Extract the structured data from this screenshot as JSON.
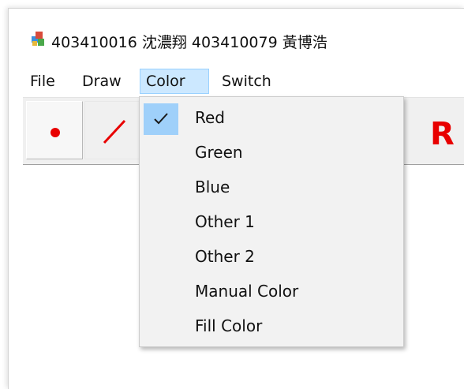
{
  "window": {
    "title": "403410016 沈濃翔 403410079 黃博浩"
  },
  "menubar": {
    "items": [
      {
        "label": "File"
      },
      {
        "label": "Draw"
      },
      {
        "label": "Color"
      },
      {
        "label": "Switch"
      }
    ],
    "active": "Color"
  },
  "toolbar": {
    "buttons": [
      {
        "icon": "point-icon"
      },
      {
        "icon": "line-icon"
      }
    ],
    "color_indicator": "R"
  },
  "color_menu": {
    "items": [
      {
        "label": "Red",
        "checked": true
      },
      {
        "label": "Green",
        "checked": false
      },
      {
        "label": "Blue",
        "checked": false
      },
      {
        "label": "Other 1",
        "checked": false
      },
      {
        "label": "Other 2",
        "checked": false
      },
      {
        "label": "Manual Color",
        "checked": false
      },
      {
        "label": "Fill Color",
        "checked": false
      }
    ]
  },
  "colors": {
    "accent_red": "#e80000",
    "menu_highlight": "#cce8ff",
    "check_highlight": "#9fd0fa",
    "menu_background": "#f2f2f2",
    "toolbar_background": "#f0f0f0"
  }
}
